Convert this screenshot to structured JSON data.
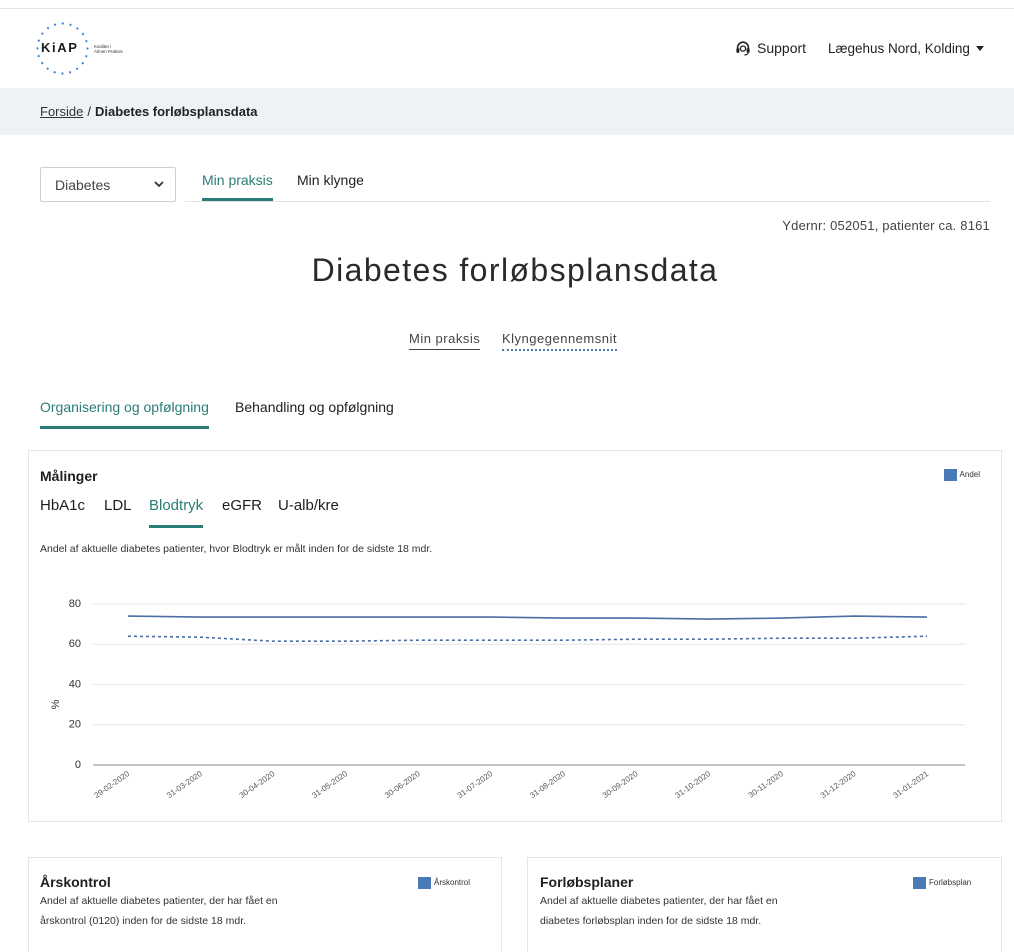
{
  "header": {
    "logo_text": "KiAP",
    "logo_tagline_line1": "Kvalitet i",
    "logo_tagline_line2": "Almen Praksis",
    "support_label": "Support",
    "support_icon": "headset-icon",
    "clinic_menu_label": "Lægehus Nord, Kolding",
    "clinic_menu_icon": "caret-down-icon"
  },
  "breadcrumb": {
    "home_label": "Forside",
    "separator": "/",
    "current_label": "Diabetes forløbsplansdata"
  },
  "disease_select": {
    "selected": "Diabetes",
    "icon": "chevron-down-icon"
  },
  "view_tabs": [
    {
      "label": "Min praksis",
      "active": true
    },
    {
      "label": "Min klynge",
      "active": false
    }
  ],
  "provider_info": "Ydernr: 052051, patienter ca. 8161",
  "page_title": "Diabetes forløbsplansdata",
  "comparison_links": [
    {
      "label": "Min praksis",
      "active": true
    },
    {
      "label": "Klyngegennemsnit",
      "active": false
    }
  ],
  "section_tabs": [
    {
      "label": "Organisering og opfølgning",
      "active": true
    },
    {
      "label": "Behandling og opfølgning",
      "active": false
    }
  ],
  "measurements_card": {
    "title": "Målinger",
    "tabs": [
      {
        "label": "HbA1c",
        "active": false
      },
      {
        "label": "LDL",
        "active": false
      },
      {
        "label": "Blodtryk",
        "active": true
      },
      {
        "label": "eGFR",
        "active": false
      },
      {
        "label": "U-alb/kre",
        "active": false
      }
    ],
    "description": "Andel af aktuelle diabetes patienter, hvor Blodtryk er målt inden for de sidste 18 mdr."
  },
  "chart_data": {
    "type": "line",
    "ylabel": "%",
    "x": [
      "29-02-2020",
      "31-03-2020",
      "30-04-2020",
      "31-05-2020",
      "30-06-2020",
      "31-07-2020",
      "31-08-2020",
      "30-09-2020",
      "31-10-2020",
      "30-11-2020",
      "31-12-2020",
      "31-01-2021"
    ],
    "series": [
      {
        "name": "Andel",
        "line_style": "solid",
        "values": [
          74,
          73.5,
          73.5,
          73.5,
          73.5,
          73.5,
          73,
          73,
          72.5,
          73,
          74,
          73.5
        ]
      },
      {
        "line_style": "dashed",
        "values": [
          64,
          63.5,
          61.5,
          61.5,
          62,
          62,
          62,
          62.5,
          62.5,
          63,
          63,
          64
        ]
      }
    ],
    "yticks": [
      0,
      20,
      40,
      60,
      80
    ],
    "ylim": [
      0,
      80
    ],
    "grid": true,
    "legend_position": "top-right"
  },
  "annual_control_card": {
    "title": "Årskontrol",
    "legend_label": "Årskontrol",
    "description": "Andel af aktuelle diabetes patienter, der har fået en årskontrol (0120) inden for de sidste 18 mdr."
  },
  "care_plan_card": {
    "title": "Forløbsplaner",
    "legend_label": "Forløbsplan",
    "description": "Andel af aktuelle diabetes patienter, der har fået en diabetes forløbsplan inden for de sidste 18 mdr."
  },
  "colors": {
    "accent": "#2a7d76",
    "series": "#4c6fa3",
    "legend": "#4b79b5",
    "breadcrumb_background": "#eef2f6",
    "logo_dots": "#3d7fd6"
  }
}
